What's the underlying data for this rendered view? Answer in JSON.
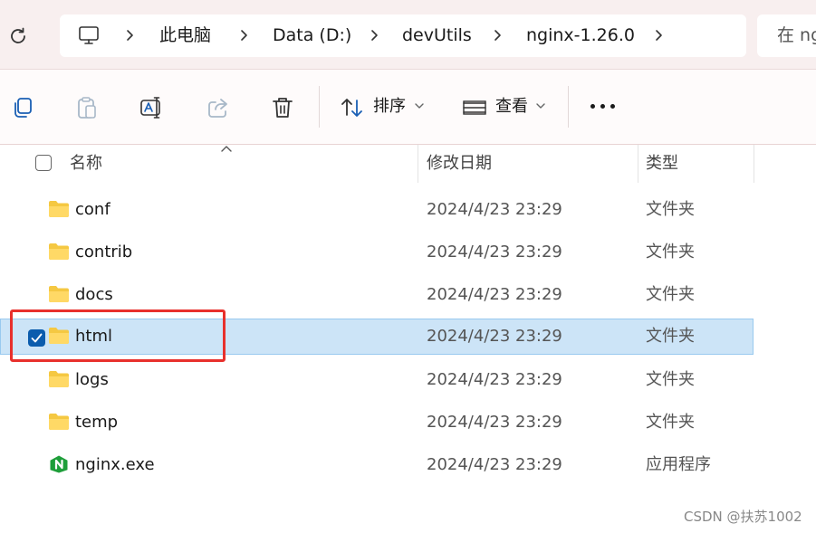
{
  "address_bar": {
    "crumbs": [
      "此电脑",
      "Data (D:)",
      "devUtils",
      "nginx-1.26.0"
    ],
    "search_placeholder": "在 ng"
  },
  "toolbar": {
    "sort_label": "排序",
    "view_label": "查看"
  },
  "columns": {
    "name": "名称",
    "date": "修改日期",
    "type": "类型"
  },
  "rows": [
    {
      "name": "conf",
      "date": "2024/4/23 23:29",
      "type": "文件夹",
      "icon": "folder-icon",
      "selected": false
    },
    {
      "name": "contrib",
      "date": "2024/4/23 23:29",
      "type": "文件夹",
      "icon": "folder-icon",
      "selected": false
    },
    {
      "name": "docs",
      "date": "2024/4/23 23:29",
      "type": "文件夹",
      "icon": "folder-icon",
      "selected": false
    },
    {
      "name": "html",
      "date": "2024/4/23 23:29",
      "type": "文件夹",
      "icon": "folder-icon",
      "selected": true
    },
    {
      "name": "logs",
      "date": "2024/4/23 23:29",
      "type": "文件夹",
      "icon": "folder-icon",
      "selected": false
    },
    {
      "name": "temp",
      "date": "2024/4/23 23:29",
      "type": "文件夹",
      "icon": "folder-icon",
      "selected": false
    },
    {
      "name": "nginx.exe",
      "date": "2024/4/23 23:29",
      "type": "应用程序",
      "icon": "nginx-app-icon",
      "selected": false
    }
  ],
  "watermark": "CSDN @扶苏1002",
  "colors": {
    "selection_bg": "#cce4f7",
    "checkbox_accent": "#0b5cad",
    "highlight_border": "#e8302c",
    "folder": "#f5c842",
    "nginx_green": "#1e9e3a"
  }
}
